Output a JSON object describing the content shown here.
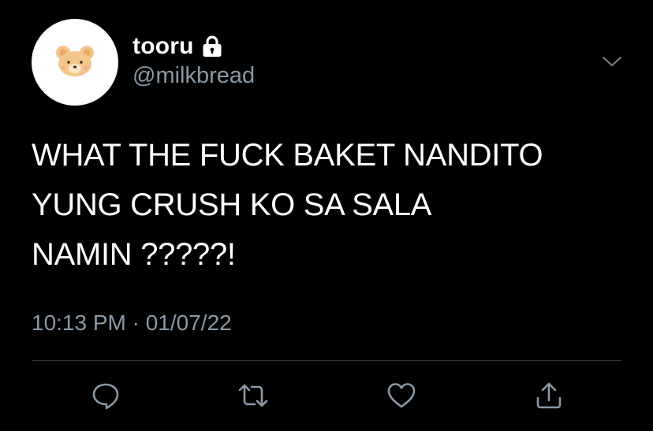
{
  "user": {
    "display_name": "tooru",
    "handle": "@milkbread",
    "avatar_icon": "bear-face-icon",
    "locked": true
  },
  "tweet": {
    "lines": [
      "WHAT THE FUCK BAKET NANDITO",
      "YUNG CRUSH KO SA SALA",
      "NAMIN ?????!"
    ],
    "timestamp": "10:13 PM · 01/07/22"
  },
  "actions": [
    {
      "name": "reply",
      "icon": "comment-icon"
    },
    {
      "name": "retweet",
      "icon": "retweet-icon"
    },
    {
      "name": "like",
      "icon": "heart-icon"
    },
    {
      "name": "share",
      "icon": "share-icon"
    }
  ],
  "colors": {
    "background": "#000000",
    "primary_text": "#ffffff",
    "secondary_text": "#8b98a5",
    "divider": "#2f3336"
  }
}
